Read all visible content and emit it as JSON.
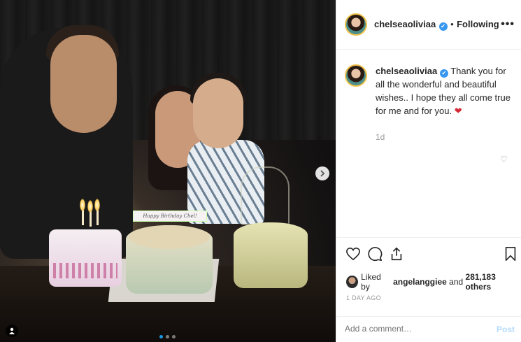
{
  "photo": {
    "topper_text": "Happy Birthday Chel!",
    "carousel": {
      "count": 3,
      "active_index": 0
    }
  },
  "header": {
    "username": "chelseaoliviaa",
    "verified_mark": "✔",
    "separator": "•",
    "follow_status": "Following",
    "more_icon": "•••"
  },
  "caption": {
    "username": "chelseaoliviaa",
    "verified_mark": "✔",
    "text": "Thank you for all the wonderful and beautiful wishes.. I hope they all come true for me and for you.",
    "emoji": "❤"
  },
  "comment_meta": {
    "age": "1d",
    "like_icon": "♡"
  },
  "likes": {
    "prefix": "Liked by",
    "user": "angelanggiee",
    "connector": "and",
    "others": "281,183 others"
  },
  "post_date": "1 DAY AGO",
  "comment_box": {
    "placeholder": "Add a comment…",
    "post_label": "Post"
  },
  "colors": {
    "link_blue": "#3897f0",
    "post_disabled": "#b3dbff",
    "heart": "#d42a34"
  }
}
